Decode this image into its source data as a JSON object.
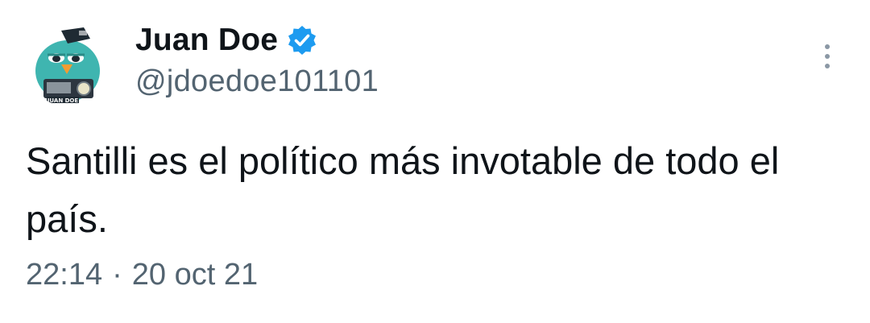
{
  "author": {
    "display_name": "Juan Doe",
    "handle": "@jdoedoe101101",
    "verified": true,
    "avatar_caption": "JUAN DOE",
    "avatar_color": "#3fb5b0"
  },
  "icons": {
    "verified": "verified-badge-icon",
    "more": "more-options-icon"
  },
  "colors": {
    "verified_badge": "#1d9bf0",
    "secondary_text": "#536471",
    "primary_text": "#0f1419"
  },
  "tweet": {
    "text": "Santilli es el político más invotable de todo el país.",
    "time": "22:14",
    "separator": "·",
    "date": "20 oct 21"
  }
}
